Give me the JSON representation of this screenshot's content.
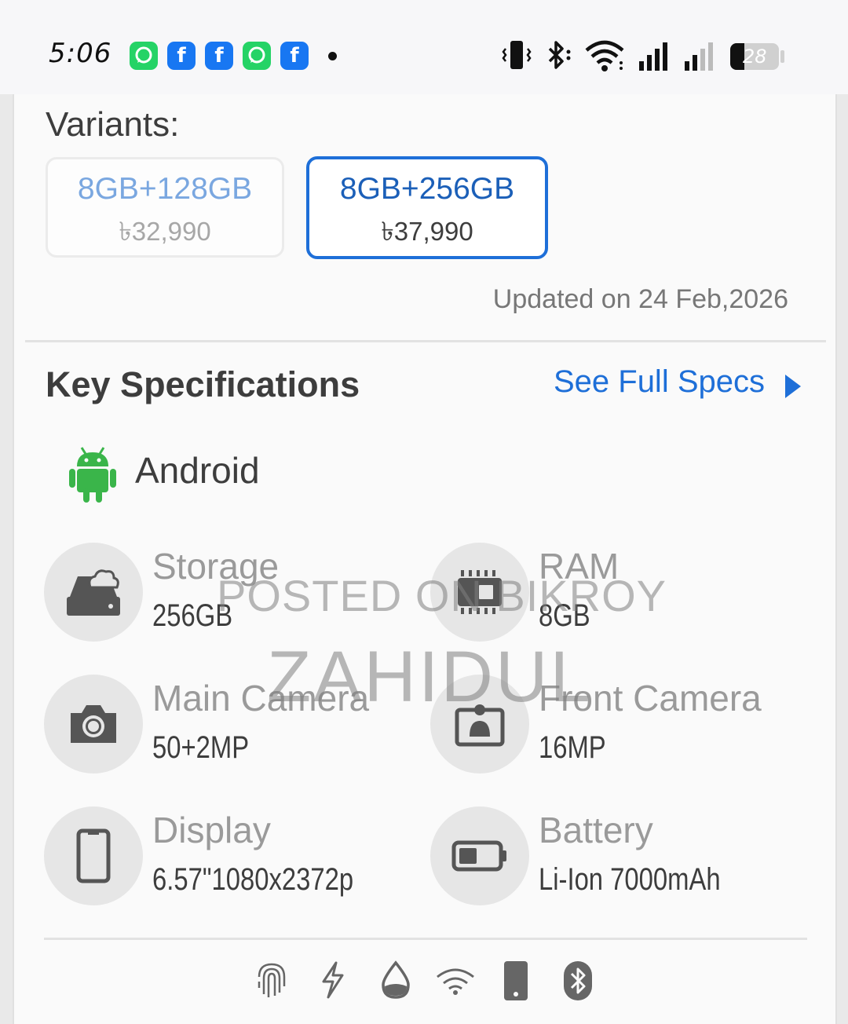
{
  "status_bar": {
    "time": "5:06",
    "battery_level": "28",
    "notification_icons": [
      "whatsapp-icon",
      "facebook-icon",
      "facebook-icon",
      "whatsapp-icon",
      "facebook-icon"
    ],
    "system_icons": [
      "vibrate-icon",
      "bluetooth-icon",
      "wifi-icon",
      "signal-icon",
      "signal-icon",
      "battery-icon"
    ]
  },
  "variants": {
    "title": "Variants:",
    "items": [
      {
        "memory": "8GB+128GB",
        "price": "৳32,990",
        "selected": false
      },
      {
        "memory": "8GB+256GB",
        "price": "৳37,990",
        "selected": true
      }
    ],
    "updated": "Updated on 24 Feb,2026"
  },
  "key_specs": {
    "title": "Key Specifications",
    "see_full_label": "See Full Specs",
    "os": "Android",
    "items": [
      {
        "label": "Storage",
        "value": "256GB",
        "icon": "storage-cloud-icon"
      },
      {
        "label": "RAM",
        "value": "8GB",
        "icon": "ram-chip-icon"
      },
      {
        "label": "Main Camera",
        "value": "50+2MP",
        "icon": "camera-icon"
      },
      {
        "label": "Front Camera",
        "value": "16MP",
        "icon": "front-camera-icon"
      },
      {
        "label": "Display",
        "value": "6.57\"1080x2372p",
        "icon": "display-icon"
      },
      {
        "label": "Battery",
        "value": "Li-Ion 7000mAh",
        "icon": "battery-icon"
      }
    ]
  },
  "watermark": {
    "line1": "POSTED ON BIKROY",
    "line2": "ZAHIDUL"
  },
  "feature_icons": [
    "fingerprint-icon",
    "fast-charging-icon",
    "water-resistant-icon",
    "wifi-icon",
    "phone-icon",
    "bluetooth-icon"
  ],
  "colors": {
    "accent": "#1e6fd8",
    "android": "#3ab54a"
  }
}
